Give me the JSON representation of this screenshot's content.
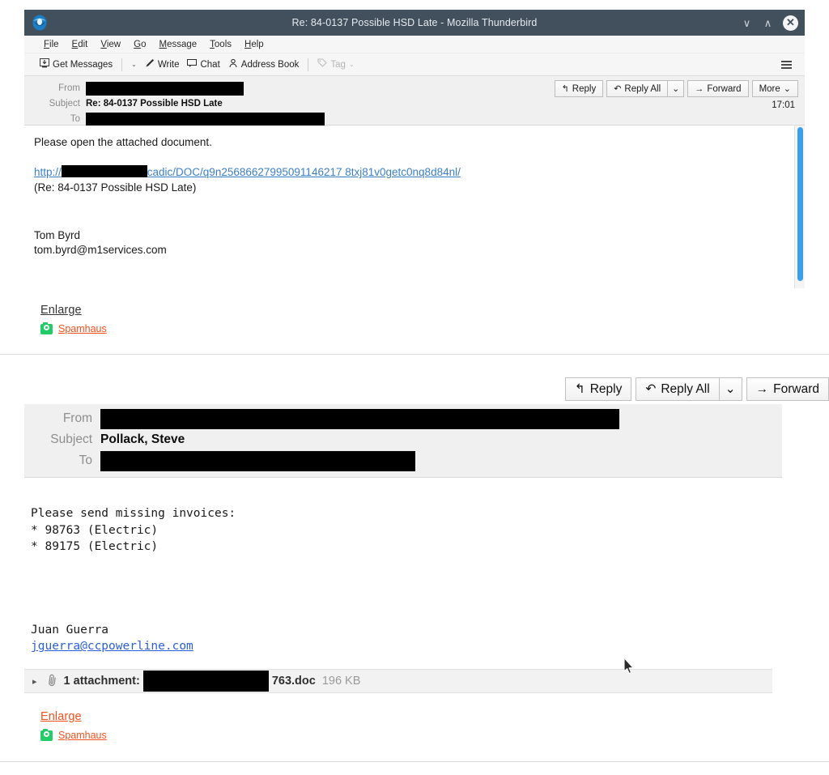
{
  "window": {
    "title": "Re: 84-0137 Possible HSD Late - Mozilla Thunderbird",
    "minimize_label": "∨",
    "maximize_label": "∧",
    "close_label": "✕",
    "logo_icon": "thunderbird-logo-icon"
  },
  "menubar": {
    "items": [
      {
        "label": "File",
        "accel": "F"
      },
      {
        "label": "Edit",
        "accel": "E"
      },
      {
        "label": "View",
        "accel": "V"
      },
      {
        "label": "Go",
        "accel": "G"
      },
      {
        "label": "Message",
        "accel": "M"
      },
      {
        "label": "Tools",
        "accel": "T"
      },
      {
        "label": "Help",
        "accel": "H"
      }
    ]
  },
  "toolbar": {
    "get_messages": "Get Messages",
    "get_messages_caret": "⌄",
    "write": "Write",
    "chat": "Chat",
    "address_book": "Address Book",
    "tag": "Tag",
    "tag_caret": "⌄",
    "menu_icon": "hamburger-menu-icon"
  },
  "message1": {
    "from_label": "From",
    "from_value_redacted": true,
    "subject_label": "Subject",
    "subject_value": "Re: 84-0137 Possible HSD Late",
    "to_label": "To",
    "to_value_redacted": true,
    "time": "17:01",
    "actions": {
      "reply": "Reply",
      "reply_all": "Reply All",
      "reply_all_caret": "⌄",
      "forward": "Forward",
      "more": "More",
      "more_caret": "⌄"
    },
    "body": {
      "line1": "Please open the attached document.",
      "link_prefix": "http://",
      "link_suffix": "cadic/DOC/q9n25686627995091146217 8txj81v0getc0nq8d84nl/",
      "line_subject_echo": "(Re: 84-0137 Possible HSD Late)",
      "signature_name": "Tom Byrd",
      "signature_email": "tom.byrd@m1services.com"
    }
  },
  "footer1": {
    "enlarge": "Enlarge",
    "spamhaus": "Spamhaus",
    "camera_icon": "camera-icon",
    "enlarge_color": "#343434"
  },
  "message2": {
    "from_label": "From",
    "from_value_redacted": true,
    "subject_label": "Subject",
    "subject_value": "Pollack, Steve",
    "to_label": "To",
    "to_value_redacted": true,
    "actions": {
      "reply": "Reply",
      "reply_all": "Reply All",
      "reply_all_caret": "⌄",
      "forward": "Forward"
    },
    "body": {
      "line1": "Please send missing invoices:",
      "line2": "* 98763 (Electric)",
      "line3": "* 89175 (Electric)",
      "signature_name": "Juan Guerra",
      "signature_email": "jguerra@ccpowerline.com"
    },
    "attachment": {
      "twisty": "▸",
      "clip_icon": "paperclip-icon",
      "count_label": "1 attachment:",
      "filename_suffix": "763.doc",
      "size": "196 KB"
    }
  },
  "footer2": {
    "enlarge": "Enlarge",
    "spamhaus": "Spamhaus",
    "camera_icon": "camera-icon",
    "enlarge_color": "#f4511e"
  },
  "colors": {
    "titlebar_bg": "#42505e",
    "link_blue": "#3a7fc6",
    "accent_orange": "#f4511e",
    "spamhaus_green": "#22cc66",
    "scrollbar_blue": "#39a0e8"
  }
}
